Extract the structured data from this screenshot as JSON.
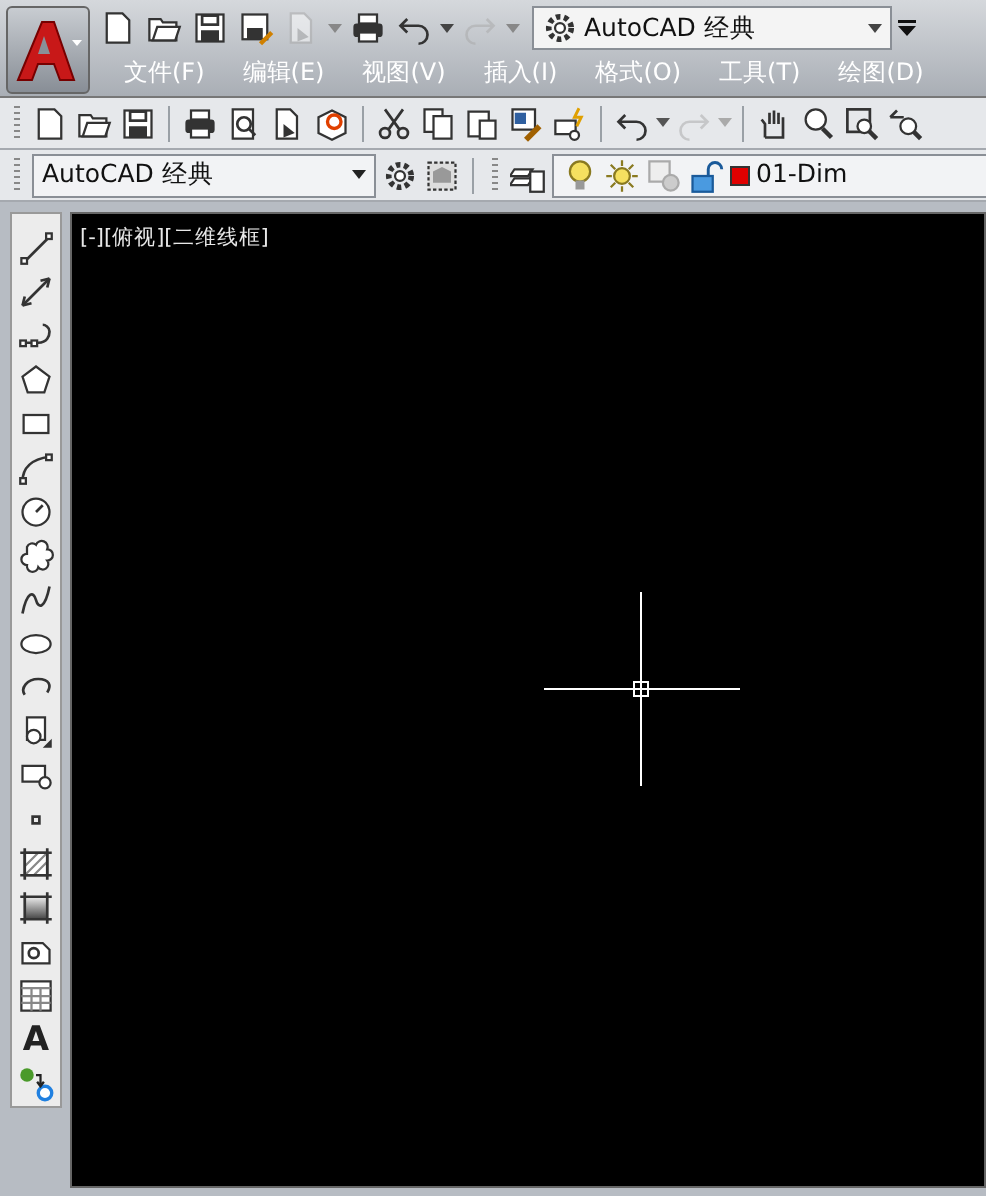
{
  "quick_access": [
    {
      "kind": "new",
      "disabled": false,
      "dropdown": false
    },
    {
      "kind": "open",
      "disabled": false,
      "dropdown": false
    },
    {
      "kind": "save",
      "disabled": false,
      "dropdown": false
    },
    {
      "kind": "save-as",
      "disabled": false,
      "dropdown": false
    },
    {
      "kind": "publish",
      "disabled": true,
      "dropdown": true
    },
    {
      "kind": "plot",
      "disabled": false,
      "dropdown": false
    },
    {
      "kind": "undo",
      "disabled": false,
      "dropdown": true
    },
    {
      "kind": "redo",
      "disabled": true,
      "dropdown": true
    }
  ],
  "workspace_selector": {
    "value": "AutoCAD 经典"
  },
  "menu": [
    "文件(F)",
    "编辑(E)",
    "视图(V)",
    "插入(I)",
    "格式(O)",
    "工具(T)",
    "绘图(D)"
  ],
  "standard_toolbar": [
    {
      "kind": "new",
      "disabled": false,
      "dropdown": false
    },
    {
      "kind": "open",
      "disabled": false,
      "dropdown": false
    },
    {
      "kind": "save",
      "disabled": false,
      "dropdown": false
    },
    {
      "kind": "separator"
    },
    {
      "kind": "plot",
      "disabled": false,
      "dropdown": false
    },
    {
      "kind": "preview",
      "disabled": false,
      "dropdown": false
    },
    {
      "kind": "publish",
      "disabled": false,
      "dropdown": false
    },
    {
      "kind": "dwf",
      "disabled": false,
      "dropdown": false
    },
    {
      "kind": "separator"
    },
    {
      "kind": "cut",
      "disabled": false,
      "dropdown": false
    },
    {
      "kind": "copy",
      "disabled": false,
      "dropdown": false
    },
    {
      "kind": "paste",
      "disabled": false,
      "dropdown": false
    },
    {
      "kind": "brush",
      "disabled": false,
      "dropdown": false
    },
    {
      "kind": "block",
      "disabled": false,
      "dropdown": false
    },
    {
      "kind": "separator"
    },
    {
      "kind": "undo",
      "disabled": false,
      "dropdown": true
    },
    {
      "kind": "redo",
      "disabled": true,
      "dropdown": true
    },
    {
      "kind": "separator"
    },
    {
      "kind": "pan",
      "disabled": false,
      "dropdown": false
    },
    {
      "kind": "zoom",
      "disabled": false,
      "dropdown": false
    },
    {
      "kind": "zoom-window",
      "disabled": false,
      "dropdown": false
    },
    {
      "kind": "zoom-previous",
      "disabled": false,
      "dropdown": false
    }
  ],
  "workspace_toolbar": {
    "value": "AutoCAD 经典"
  },
  "layer_toolbar": {
    "on": true,
    "thawed": true,
    "unlocked": true,
    "layer": "01-Dim"
  },
  "draw_toolbar": [
    {
      "kind": "line"
    },
    {
      "kind": "xline"
    },
    {
      "kind": "polyline"
    },
    {
      "kind": "polygon"
    },
    {
      "kind": "rectangle"
    },
    {
      "kind": "arc"
    },
    {
      "kind": "circle"
    },
    {
      "kind": "cloud"
    },
    {
      "kind": "spline"
    },
    {
      "kind": "ellipse"
    },
    {
      "kind": "ellipse-arc"
    },
    {
      "kind": "insert"
    },
    {
      "kind": "make-block"
    },
    {
      "kind": "point"
    },
    {
      "kind": "hatch"
    },
    {
      "kind": "gradient"
    },
    {
      "kind": "region"
    },
    {
      "kind": "table"
    },
    {
      "kind": "text",
      "label": "A"
    },
    {
      "kind": "add-selected"
    }
  ],
  "viewport": {
    "label": "[-][俯视][二维线框]"
  }
}
